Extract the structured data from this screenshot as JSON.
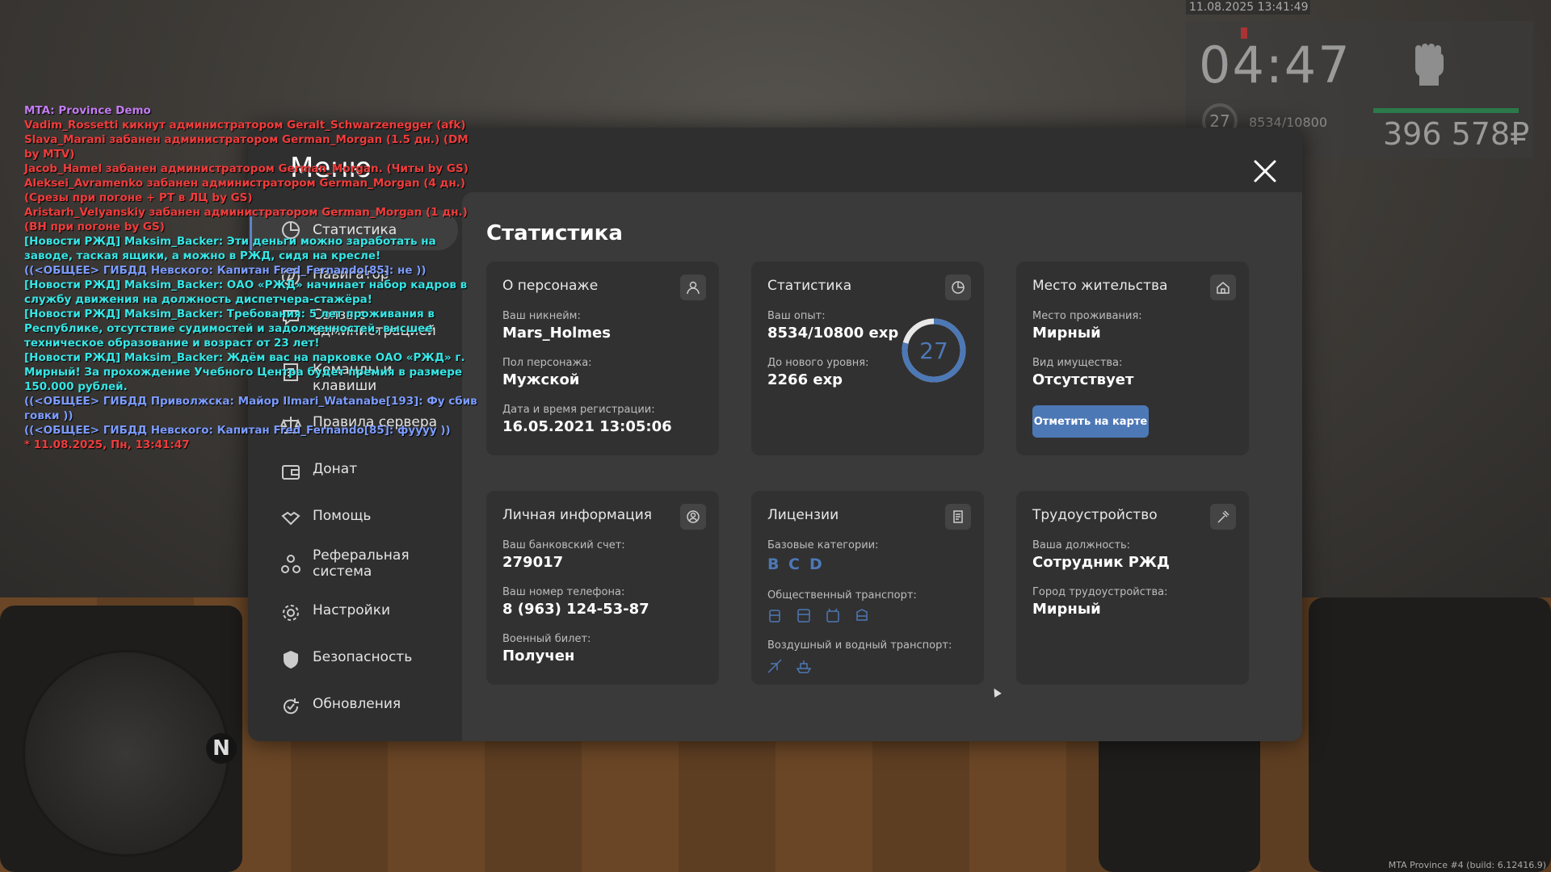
{
  "hud": {
    "datetime": "11.08.2025 13:41:49",
    "time": "04:47",
    "level": "27",
    "exp": "8534/10800",
    "money": "396 578₽"
  },
  "chat": [
    {
      "text": "MTA: Province Demo",
      "color": "purple"
    },
    {
      "text": "Vadim_Rossetti кикнут администратором Geralt_Schwarzenegger (afk)",
      "color": "red"
    },
    {
      "text": "Slava_Marani забанен администратором German_Morgan (1.5 дн.) (DM by MTV)",
      "color": "red"
    },
    {
      "text": "Jacob_Hamel забанен администратором German_Morgan. (Читы by GS)",
      "color": "red"
    },
    {
      "text": "Aleksei_Avramenko забанен администратором German_Morgan (4 дн.) (Срезы при погоне + РТ в ЛЦ by GS)",
      "color": "red"
    },
    {
      "text": "Aristarh_Velyanskiy забанен администратором German_Morgan (1 дн.) (ВН при погоне by GS)",
      "color": "red"
    },
    {
      "text": "[Новости РЖД] Maksim_Backer: Эти деньги можно заработать на заводе, таская ящики, а можно в РЖД, сидя на кресле!",
      "color": "cyan"
    },
    {
      "text": "((<ОБЩЕЕ> ГИБДД Невского: Капитан Fred_Fernando[85]: не ))",
      "color": "blue"
    },
    {
      "text": "[Новости РЖД] Maksim_Backer: ОАО «РЖД» начинает набор кадров в службу движения на должность диспетчера-стажёра!",
      "color": "cyan"
    },
    {
      "text": "[Новости РЖД] Maksim_Backer: Требования: 5 лет проживания в Республике, отсутствие судимостей и задолженностей, высшее техническое образование и возраст от 23 лет!",
      "color": "cyan"
    },
    {
      "text": "[Новости РЖД] Maksim_Backer: Ждём вас на парковке ОАО «РЖД» г. Мирный! За прохождение Учебного Центра будет премия в размере 150.000 рублей.",
      "color": "cyan"
    },
    {
      "text": "((<ОБЩЕЕ> ГИБДД Приволжска: Майор Ilmari_Watanabe[193]: Фу сбив говки ))",
      "color": "blue"
    },
    {
      "text": "((<ОБЩЕЕ> ГИБДД Невского: Капитан Fred_Fernando[85]: фуууу ))",
      "color": "blue"
    },
    {
      "text": "* 11.08.2025, Пн, 13:41:47",
      "color": "red"
    }
  ],
  "menu": {
    "title": "Меню",
    "sidebar": [
      {
        "label": "Статистика",
        "icon": "stats-icon"
      },
      {
        "label": "Навигатор",
        "icon": "navigator-icon"
      },
      {
        "label": "Связь с администрацией",
        "icon": "chat-icon"
      },
      {
        "label": "Команды и клавиши",
        "icon": "commands-icon"
      },
      {
        "label": "Правила сервера",
        "icon": "scales-icon"
      },
      {
        "label": "Донат",
        "icon": "wallet-icon"
      },
      {
        "label": "Помощь",
        "icon": "handshake-icon"
      },
      {
        "label": "Реферальная система",
        "icon": "referral-icon"
      },
      {
        "label": "Настройки",
        "icon": "gear-icon"
      },
      {
        "label": "Безопасность",
        "icon": "shield-icon"
      },
      {
        "label": "Обновления",
        "icon": "refresh-icon"
      }
    ],
    "content_title": "Статистика",
    "cards": {
      "about": {
        "title": "О персонаже",
        "nickname_label": "Ваш никнейм:",
        "nickname": "Mars_Holmes",
        "gender_label": "Пол персонажа:",
        "gender": "Мужской",
        "reg_label": "Дата и время регистрации:",
        "reg": "16.05.2021 13:05:06"
      },
      "stats": {
        "title": "Статистика",
        "exp_label": "Ваш опыт:",
        "exp": "8534/10800 exp",
        "next_label": "До нового уровня:",
        "next": "2266 exp",
        "level": "27",
        "progress": 0.79
      },
      "residence": {
        "title": "Место жительства",
        "place_label": "Место проживания:",
        "place": "Мирный",
        "property_label": "Вид имущества:",
        "property": "Отсутствует",
        "button": "Отметить на карте"
      },
      "personal": {
        "title": "Личная информация",
        "bank_label": "Ваш банковский счет:",
        "bank": "279017",
        "phone_label": "Ваш номер телефона:",
        "phone": "8 (963) 124-53-87",
        "military_label": "Военный билет:",
        "military": "Получен"
      },
      "licenses": {
        "title": "Лицензии",
        "basic_label": "Базовые категории:",
        "categories": [
          "B",
          "C",
          "D"
        ],
        "public_label": "Общественный транспорт:",
        "air_label": "Воздушный и водный транспорт:"
      },
      "employment": {
        "title": "Трудоустройство",
        "position_label": "Ваша должность:",
        "position": "Сотрудник РЖД",
        "city_label": "Город трудоустройства:",
        "city": "Мирный"
      }
    }
  },
  "footer": "MTA Province #4 (build: 6.12416.9)",
  "minimap": {
    "north": "N"
  }
}
